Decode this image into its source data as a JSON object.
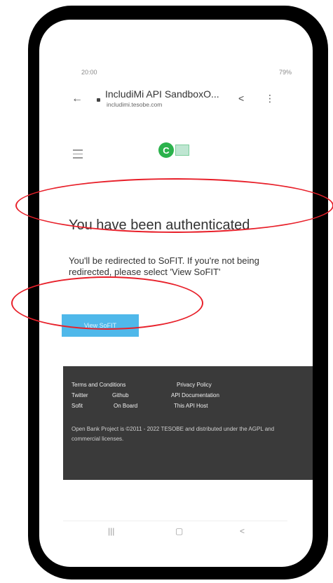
{
  "status": {
    "time": "20:00",
    "right": "79%"
  },
  "browser": {
    "title": "IncludiMi API SandboxO...",
    "url": "includimi.tesobe.com",
    "icons": {
      "back": "←",
      "share": "<",
      "menu": "⋮"
    }
  },
  "site": {
    "logo_letter": "C",
    "heading": "You have been authenticated",
    "message": "You'll be redirected to SoFIT. If you're not being redirected, please select 'View SoFIT'",
    "button_label": "View SoFIT"
  },
  "footer": {
    "links": {
      "terms": "Terms and Conditions",
      "privacy": "Privacy Policy",
      "twitter": "Twitter",
      "github": "Github",
      "api_docs": "API Documentation",
      "sofit": "Sofit",
      "on_board": "On Board",
      "api_host": "This API Host"
    },
    "copyright": "Open Bank Project is ©2011 - 2022 TESOBE and distributed under the AGPL and commercial licenses."
  },
  "navbar": {
    "recents": "|||",
    "home": "▢",
    "back": "<"
  },
  "colors": {
    "annotation": "#e8202a",
    "button": "#4fb8ea",
    "footer_bg": "#3a3a3a"
  }
}
